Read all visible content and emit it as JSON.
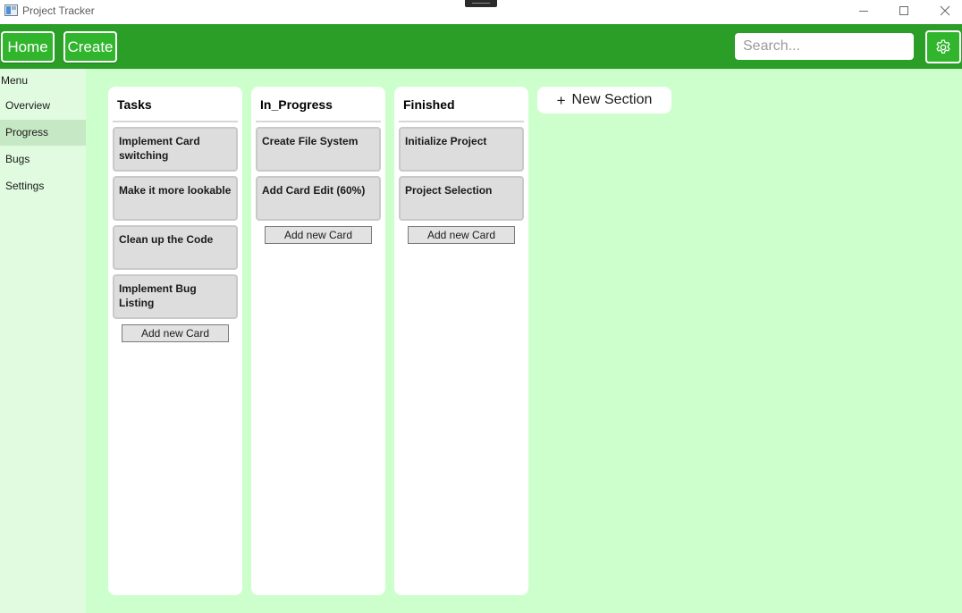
{
  "window": {
    "title": "Project Tracker"
  },
  "toolbar": {
    "home_label": "Home",
    "create_label": "Create",
    "search_placeholder": "Search..."
  },
  "sidebar": {
    "menu_label": "Menu",
    "items": [
      {
        "label": "Overview"
      },
      {
        "label": "Progress"
      },
      {
        "label": "Bugs"
      },
      {
        "label": "Settings"
      }
    ]
  },
  "board": {
    "sections": [
      {
        "title": "Tasks",
        "cards": [
          {
            "text": "Implement Card switching"
          },
          {
            "text": "Make it more lookable"
          },
          {
            "text": "Clean up the Code"
          },
          {
            "text": "Implement Bug Listing"
          }
        ],
        "add_label": "Add new Card"
      },
      {
        "title": "In_Progress",
        "cards": [
          {
            "text": "Create File System"
          },
          {
            "text": "Add Card Edit (60%)"
          }
        ],
        "add_label": "Add new Card"
      },
      {
        "title": "Finished",
        "cards": [
          {
            "text": "Initialize Project"
          },
          {
            "text": "Project Selection"
          }
        ],
        "add_label": "Add new Card"
      }
    ],
    "new_section_label": "New Section",
    "new_section_icon": "+"
  },
  "icons": {
    "app": "app-window-icon",
    "minimize": "minimize-icon",
    "maximize": "maximize-icon",
    "close": "close-icon",
    "settings": "gear-icon",
    "add": "plus-icon"
  },
  "colors": {
    "toolbar": "#2a9e27",
    "button": "#30b52d",
    "sidebar": "#e0fbe0",
    "sidebar_active": "#c7e8c4",
    "board_background": "#ccffcc",
    "card": "#dddddd"
  }
}
